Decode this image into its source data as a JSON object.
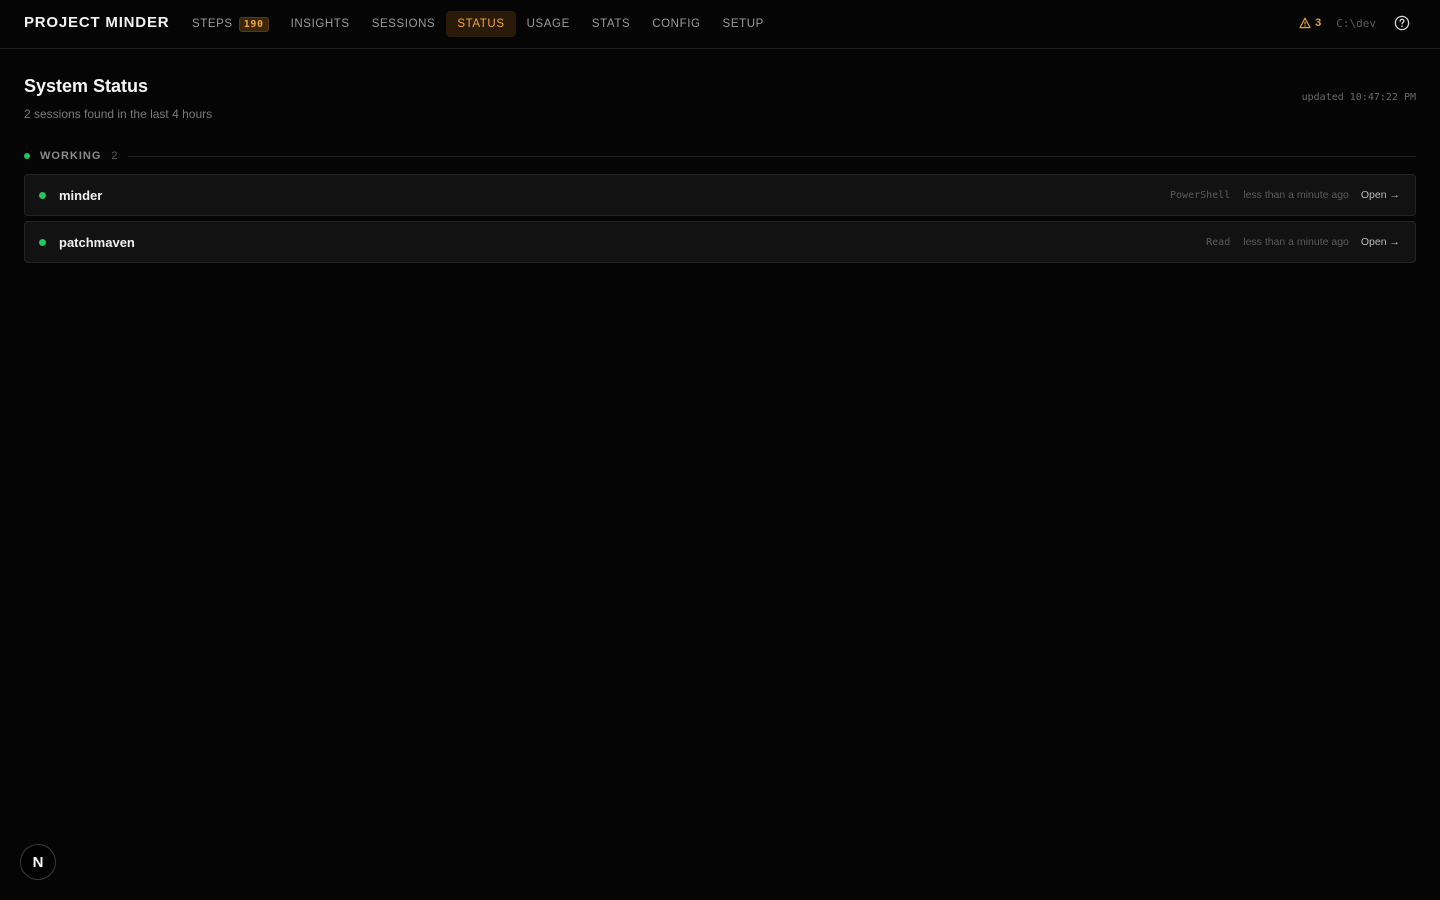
{
  "app": {
    "title": "PROJECT MINDER"
  },
  "nav": {
    "items": [
      {
        "label": "STEPS",
        "badge": "190"
      },
      {
        "label": "INSIGHTS"
      },
      {
        "label": "SESSIONS"
      },
      {
        "label": "STATUS",
        "active": true
      },
      {
        "label": "USAGE"
      },
      {
        "label": "STATS"
      },
      {
        "label": "CONFIG"
      },
      {
        "label": "SETUP"
      }
    ]
  },
  "toolbar": {
    "warnings_count": "3",
    "path": "C:\\dev",
    "warning_icon": "warning-triangle-icon",
    "help_icon": "help-circle-icon"
  },
  "page": {
    "title": "System Status",
    "subtitle": "2 sessions found in the last 4 hours",
    "updated": "updated 10:47:22 PM"
  },
  "section": {
    "label": "WORKING",
    "count": "2",
    "color": "#22c55e"
  },
  "sessions": [
    {
      "name": "minder",
      "tool": "PowerShell",
      "time": "less than a minute ago",
      "action": "Open →"
    },
    {
      "name": "patchmaven",
      "tool": "Read",
      "time": "less than a minute ago",
      "action": "Open →"
    }
  ],
  "fab": {
    "label": "N"
  },
  "colors": {
    "accent": "#f0a63c",
    "status_working": "#22c55e",
    "background": "#050505"
  }
}
